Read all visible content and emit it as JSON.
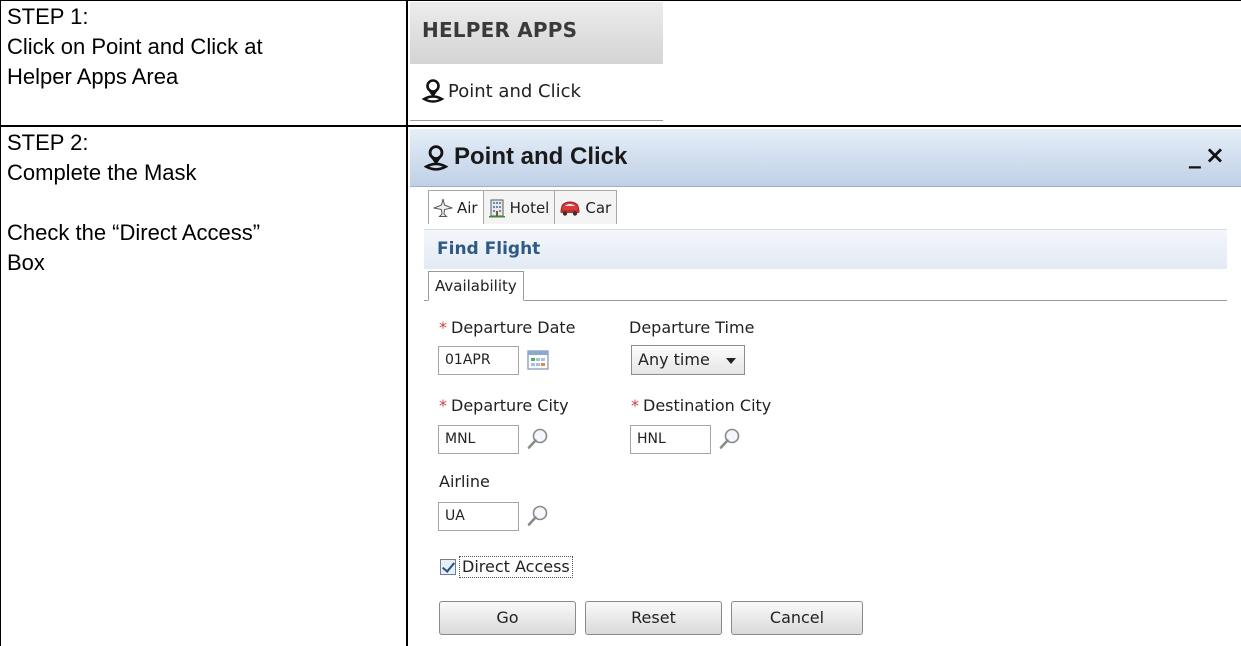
{
  "steps": [
    {
      "heading": "STEP 1:",
      "lines": [
        "Click on Point and Click at",
        "Helper Apps Area"
      ]
    },
    {
      "heading": "STEP 2:",
      "lines": [
        "Complete the Mask",
        "",
        "Check the “Direct Access”",
        "Box"
      ]
    }
  ],
  "helper_apps": {
    "header": "HELPER APPS",
    "item_label": "Point and Click",
    "item_icon": "location-pin-icon"
  },
  "dialog": {
    "title": "Point and Click",
    "minimize": "_",
    "close": "×",
    "tabs": [
      {
        "label": "Air",
        "icon": "airplane-icon",
        "active": true
      },
      {
        "label": "Hotel",
        "icon": "hotel-icon",
        "active": false
      },
      {
        "label": "Car",
        "icon": "car-icon",
        "active": false
      }
    ],
    "section_title": "Find Flight",
    "subtab": "Availability",
    "required_marker": "*",
    "fields": {
      "departure_date": {
        "label": "Departure Date",
        "value": "01APR",
        "required": true
      },
      "departure_time": {
        "label": "Departure Time",
        "value": "Any time"
      },
      "departure_city": {
        "label": "Departure City",
        "value": "MNL",
        "required": true
      },
      "destination_city": {
        "label": "Destination City",
        "value": "HNL",
        "required": true
      },
      "airline": {
        "label": "Airline",
        "value": "UA"
      }
    },
    "direct_access": {
      "label": "Direct Access",
      "checked": true
    },
    "buttons": {
      "go": "Go",
      "reset": "Reset",
      "cancel": "Cancel"
    }
  },
  "colors": {
    "title_bar_top": "#e6eef9",
    "title_bar_bottom": "#bfd0e6",
    "section_title_text": "#2f5a86",
    "required_marker": "#d23c3c"
  }
}
